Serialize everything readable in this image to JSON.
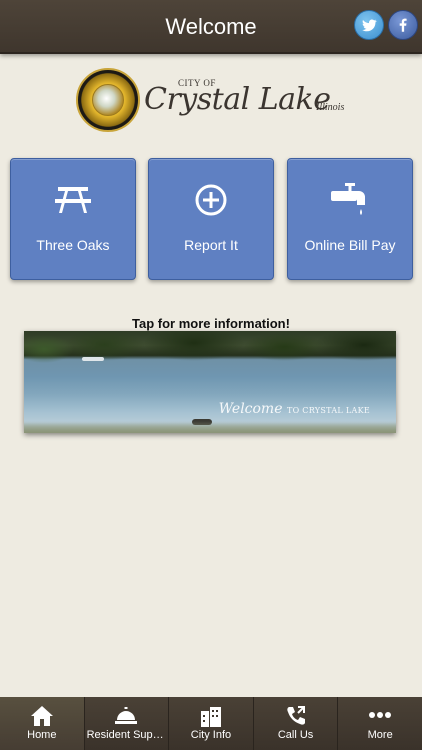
{
  "header": {
    "title": "Welcome",
    "social": [
      {
        "name": "twitter",
        "icon": "twitter-icon",
        "color": "#3c8fd0"
      },
      {
        "name": "facebook",
        "icon": "facebook-icon",
        "color": "#3b5b9e"
      }
    ]
  },
  "logo": {
    "city_of": "CITY OF",
    "name": "Crystal Lake",
    "state": "Illinois",
    "seal_text": "CITY OF CRYSTAL LAKE ILLINOIS INCORPORATED SEPTEMBER 1914"
  },
  "tiles": [
    {
      "label": "Three Oaks",
      "icon": "picnic-table-icon"
    },
    {
      "label": "Report It",
      "icon": "plus-circle-icon"
    },
    {
      "label": "Online Bill Pay",
      "icon": "water-faucet-icon"
    }
  ],
  "info": {
    "label": "Tap for more information!",
    "banner_caption_main": "Welcome",
    "banner_caption_sub": "TO CRYSTAL LAKE"
  },
  "tabbar": {
    "items": [
      {
        "label": "Home",
        "icon": "home-icon"
      },
      {
        "label": "Resident Supp...",
        "icon": "service-bell-icon"
      },
      {
        "label": "City Info",
        "icon": "buildings-icon"
      },
      {
        "label": "Call Us",
        "icon": "phone-icon"
      },
      {
        "label": "More",
        "icon": "more-dots-icon"
      }
    ]
  },
  "colors": {
    "background": "#eeebe1",
    "header": "#4e4439",
    "tile": "#5f80c2",
    "tabbar": "#3f362d"
  }
}
